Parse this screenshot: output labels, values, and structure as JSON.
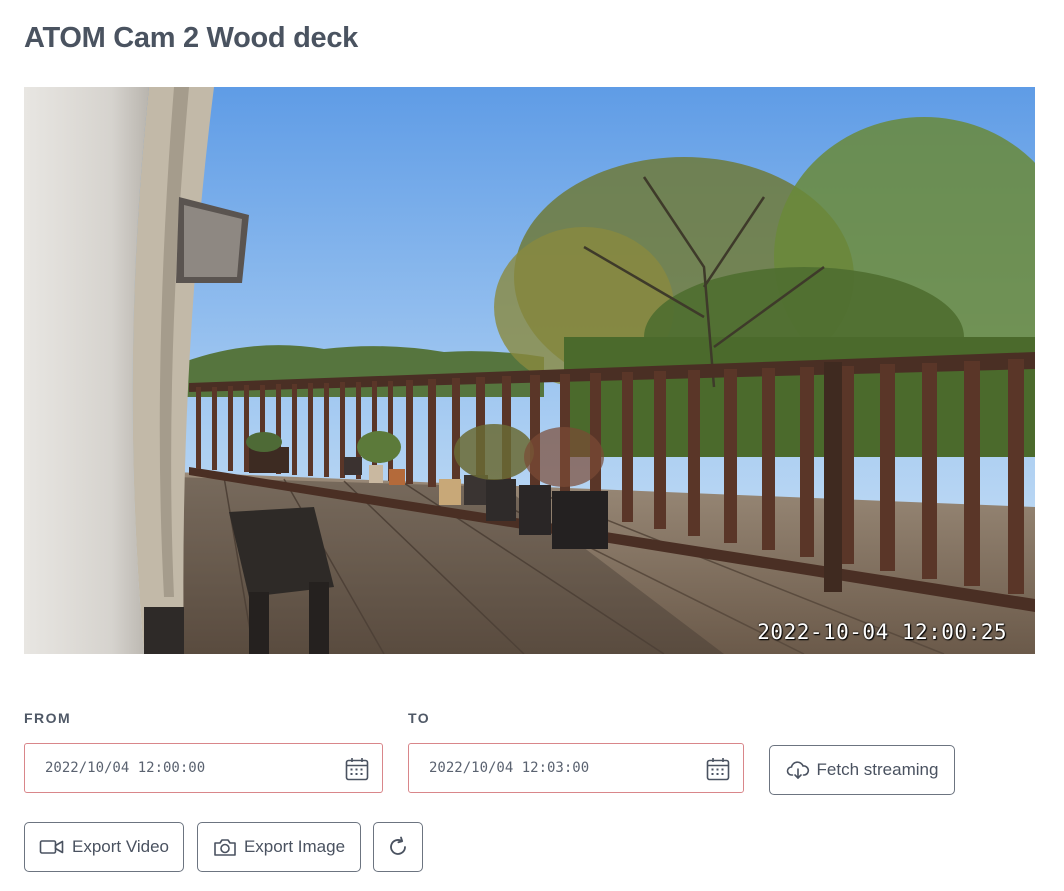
{
  "page_title": "ATOM Cam 2 Wood deck",
  "video": {
    "timestamp": "2022-10-04 12:00:25"
  },
  "from": {
    "label": "FROM",
    "value": "2022/10/04 12:00:00"
  },
  "to": {
    "label": "TO",
    "value": "2022/10/04 12:03:00"
  },
  "buttons": {
    "fetch_streaming": "Fetch streaming",
    "export_video": "Export Video",
    "export_image": "Export Image"
  },
  "icons": {
    "calendar": "calendar-icon",
    "cloud_download": "cloud-download-icon",
    "video_camera": "video-camera-icon",
    "camera": "camera-icon",
    "refresh": "refresh-icon"
  },
  "colors": {
    "field_border": "#d9868a",
    "button_border": "#6c7480",
    "title": "#4a5360"
  }
}
